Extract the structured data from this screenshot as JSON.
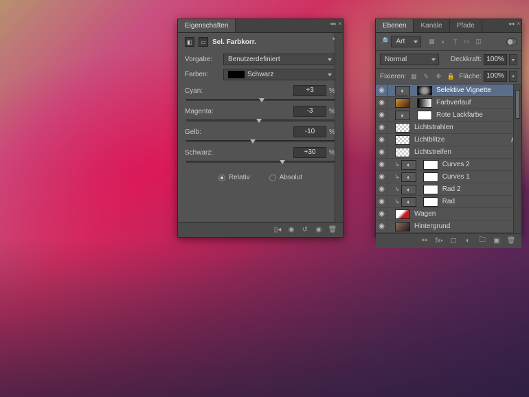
{
  "properties": {
    "title": "Eigenschaften",
    "adjustment_name": "Sel. Farbkorr.",
    "preset_label": "Vorgabe:",
    "preset_value": "Benutzerdefiniert",
    "colors_label": "Farben:",
    "colors_value": "Schwarz",
    "sliders": [
      {
        "label": "Cyan:",
        "value": "+3",
        "pos": 51
      },
      {
        "label": "Magenta:",
        "value": "-3",
        "pos": 49
      },
      {
        "label": "Gelb:",
        "value": "-10",
        "pos": 45
      },
      {
        "label": "Schwarz:",
        "value": "+30",
        "pos": 65
      }
    ],
    "pct": "%",
    "method": {
      "relative": "Relativ",
      "absolute": "Absolut",
      "selected": "relative"
    }
  },
  "layers": {
    "tabs": [
      "Ebenen",
      "Kanäle",
      "Pfade"
    ],
    "kind_label": "Art",
    "blend_mode": "Normal",
    "opacity_label": "Deckkraft:",
    "opacity_value": "100%",
    "lock_label": "Fixieren:",
    "fill_label": "Fläche:",
    "fill_value": "100%",
    "items": [
      {
        "name": "Selektive Vignette",
        "selected": true,
        "t1": "adjicon",
        "t2": "vignette"
      },
      {
        "name": "Farbverlauf",
        "selected": false,
        "t1": "grad1",
        "t2": "grad2"
      },
      {
        "name": "Rote Lackfarbe",
        "selected": false,
        "t1": "adjicon",
        "t2": "white"
      },
      {
        "name": "Lichtstrahlen",
        "selected": false,
        "t1": "checker",
        "t2": null
      },
      {
        "name": "Lichtblitze",
        "selected": false,
        "t1": "checker",
        "t2": null,
        "fx": true
      },
      {
        "name": "Lichtstreifen",
        "selected": false,
        "t1": "checker",
        "t2": null
      },
      {
        "name": "Curves 2",
        "selected": false,
        "t1": "adjicon",
        "t2": "white",
        "link": true
      },
      {
        "name": "Curves 1",
        "selected": false,
        "t1": "adjicon",
        "t2": "white",
        "link": true
      },
      {
        "name": "Rad 2",
        "selected": false,
        "t1": "adjicon",
        "t2": "white",
        "link": true
      },
      {
        "name": "Rad",
        "selected": false,
        "t1": "adjicon",
        "t2": "white",
        "link": true
      },
      {
        "name": "Wagen",
        "selected": false,
        "t1": "red",
        "t2": null
      },
      {
        "name": "Hintergrund",
        "selected": false,
        "t1": "car",
        "t2": null
      }
    ]
  }
}
